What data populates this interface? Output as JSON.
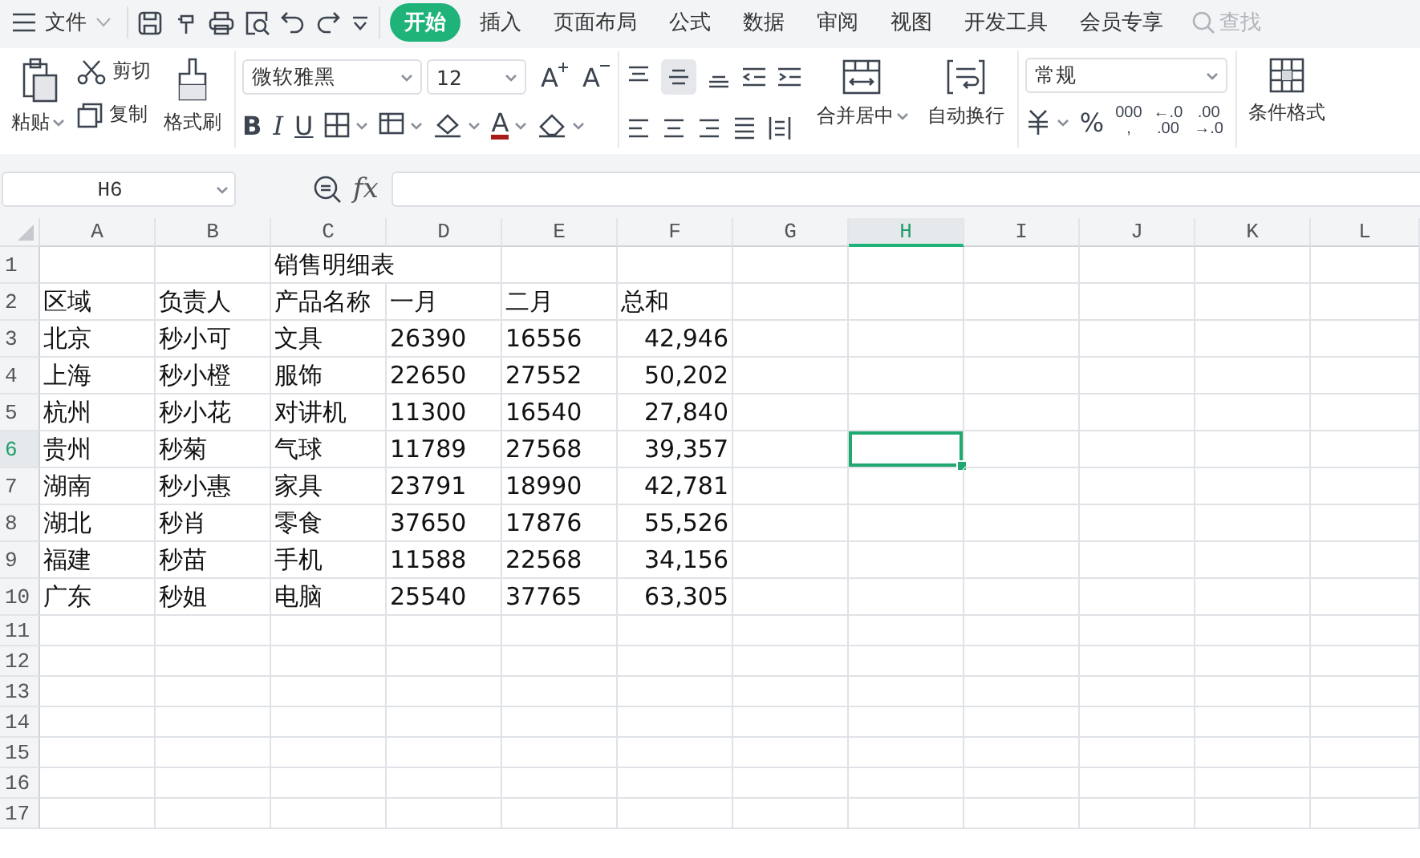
{
  "menu": {
    "file_label": "文件",
    "tabs": [
      {
        "label": "开始",
        "selected": true
      },
      {
        "label": "插入",
        "selected": false
      },
      {
        "label": "页面布局",
        "selected": false
      },
      {
        "label": "公式",
        "selected": false
      },
      {
        "label": "数据",
        "selected": false
      },
      {
        "label": "审阅",
        "selected": false
      },
      {
        "label": "视图",
        "selected": false
      },
      {
        "label": "开发工具",
        "selected": false
      },
      {
        "label": "会员专享",
        "selected": false
      }
    ],
    "search": {
      "placeholder": "查找"
    }
  },
  "ribbon": {
    "paste": "粘贴",
    "cut": "剪切",
    "copy": "复制",
    "format_painter": "格式刷",
    "font": {
      "value": "微软雅黑"
    },
    "font_size": {
      "value": "12"
    },
    "grow_font": "A",
    "shrink_font": "A",
    "bold": "B",
    "italic": "I",
    "underline": "U",
    "font_color": "A",
    "merge_center": "合并居中",
    "wrap_text": "自动换行",
    "number_format": {
      "value": "常规"
    },
    "number_buttons": [
      "%",
      "000",
      ",",
      "←.0",
      ".00",
      ".00",
      "→.0"
    ],
    "conditional_format": "条件格式"
  },
  "formula_bar": {
    "name_box": "H6",
    "fx": "fx"
  },
  "sheet": {
    "columns": [
      {
        "letter": "A",
        "kind": "text",
        "selected": false
      },
      {
        "letter": "B",
        "kind": "text",
        "selected": false
      },
      {
        "letter": "C",
        "kind": "text",
        "selected": false
      },
      {
        "letter": "D",
        "kind": "text",
        "selected": false
      },
      {
        "letter": "E",
        "kind": "text",
        "selected": false
      },
      {
        "letter": "F",
        "kind": "number",
        "selected": false
      },
      {
        "letter": "G",
        "kind": "text",
        "selected": false
      },
      {
        "letter": "H",
        "kind": "text",
        "selected": true
      },
      {
        "letter": "I",
        "kind": "text",
        "selected": false
      },
      {
        "letter": "J",
        "kind": "text",
        "selected": false
      },
      {
        "letter": "K",
        "kind": "text",
        "selected": false
      },
      {
        "letter": "L",
        "kind": "text",
        "selected": false
      }
    ],
    "rows": [
      {
        "number": "1",
        "kind": "title",
        "selected": false,
        "cells": [
          "",
          "",
          "销售明细表"
        ]
      },
      {
        "number": "2",
        "kind": "header",
        "selected": false,
        "cells": [
          "区域",
          "负责人",
          "产品名称",
          "一月",
          "二月",
          "总和"
        ]
      },
      {
        "number": "3",
        "kind": "data",
        "selected": false,
        "cells": [
          "北京",
          "秒小可",
          "文具",
          "26390",
          "16556",
          "42,946"
        ]
      },
      {
        "number": "4",
        "kind": "data",
        "selected": false,
        "cells": [
          "上海",
          "秒小橙",
          "服饰",
          "22650",
          "27552",
          "50,202"
        ]
      },
      {
        "number": "5",
        "kind": "data",
        "selected": false,
        "cells": [
          "杭州",
          "秒小花",
          "对讲机",
          "11300",
          "16540",
          "27,840"
        ]
      },
      {
        "number": "6",
        "kind": "data",
        "selected": true,
        "cells": [
          "贵州",
          "秒菊",
          "气球",
          "11789",
          "27568",
          "39,357"
        ]
      },
      {
        "number": "7",
        "kind": "data",
        "selected": false,
        "cells": [
          "湖南",
          "秒小惠",
          "家具",
          "23791",
          "18990",
          "42,781"
        ]
      },
      {
        "number": "8",
        "kind": "data",
        "selected": false,
        "cells": [
          "湖北",
          "秒肖",
          "零食",
          "37650",
          "17876",
          "55,526"
        ]
      },
      {
        "number": "9",
        "kind": "data",
        "selected": false,
        "cells": [
          "福建",
          "秒苗",
          "手机",
          "11588",
          "22568",
          "34,156"
        ]
      },
      {
        "number": "10",
        "kind": "data",
        "selected": false,
        "cells": [
          "广东",
          "秒姐",
          "电脑",
          "25540",
          "37765",
          "63,305"
        ]
      },
      {
        "number": "11",
        "kind": "blank",
        "selected": false,
        "cells": []
      },
      {
        "number": "12",
        "kind": "blank",
        "selected": false,
        "cells": []
      },
      {
        "number": "13",
        "kind": "blank",
        "selected": false,
        "cells": []
      },
      {
        "number": "14",
        "kind": "blank",
        "selected": false,
        "cells": []
      },
      {
        "number": "15",
        "kind": "blank",
        "selected": false,
        "cells": []
      },
      {
        "number": "16",
        "kind": "blank",
        "selected": false,
        "cells": []
      },
      {
        "number": "17",
        "kind": "blank",
        "selected": false,
        "cells": []
      }
    ]
  }
}
